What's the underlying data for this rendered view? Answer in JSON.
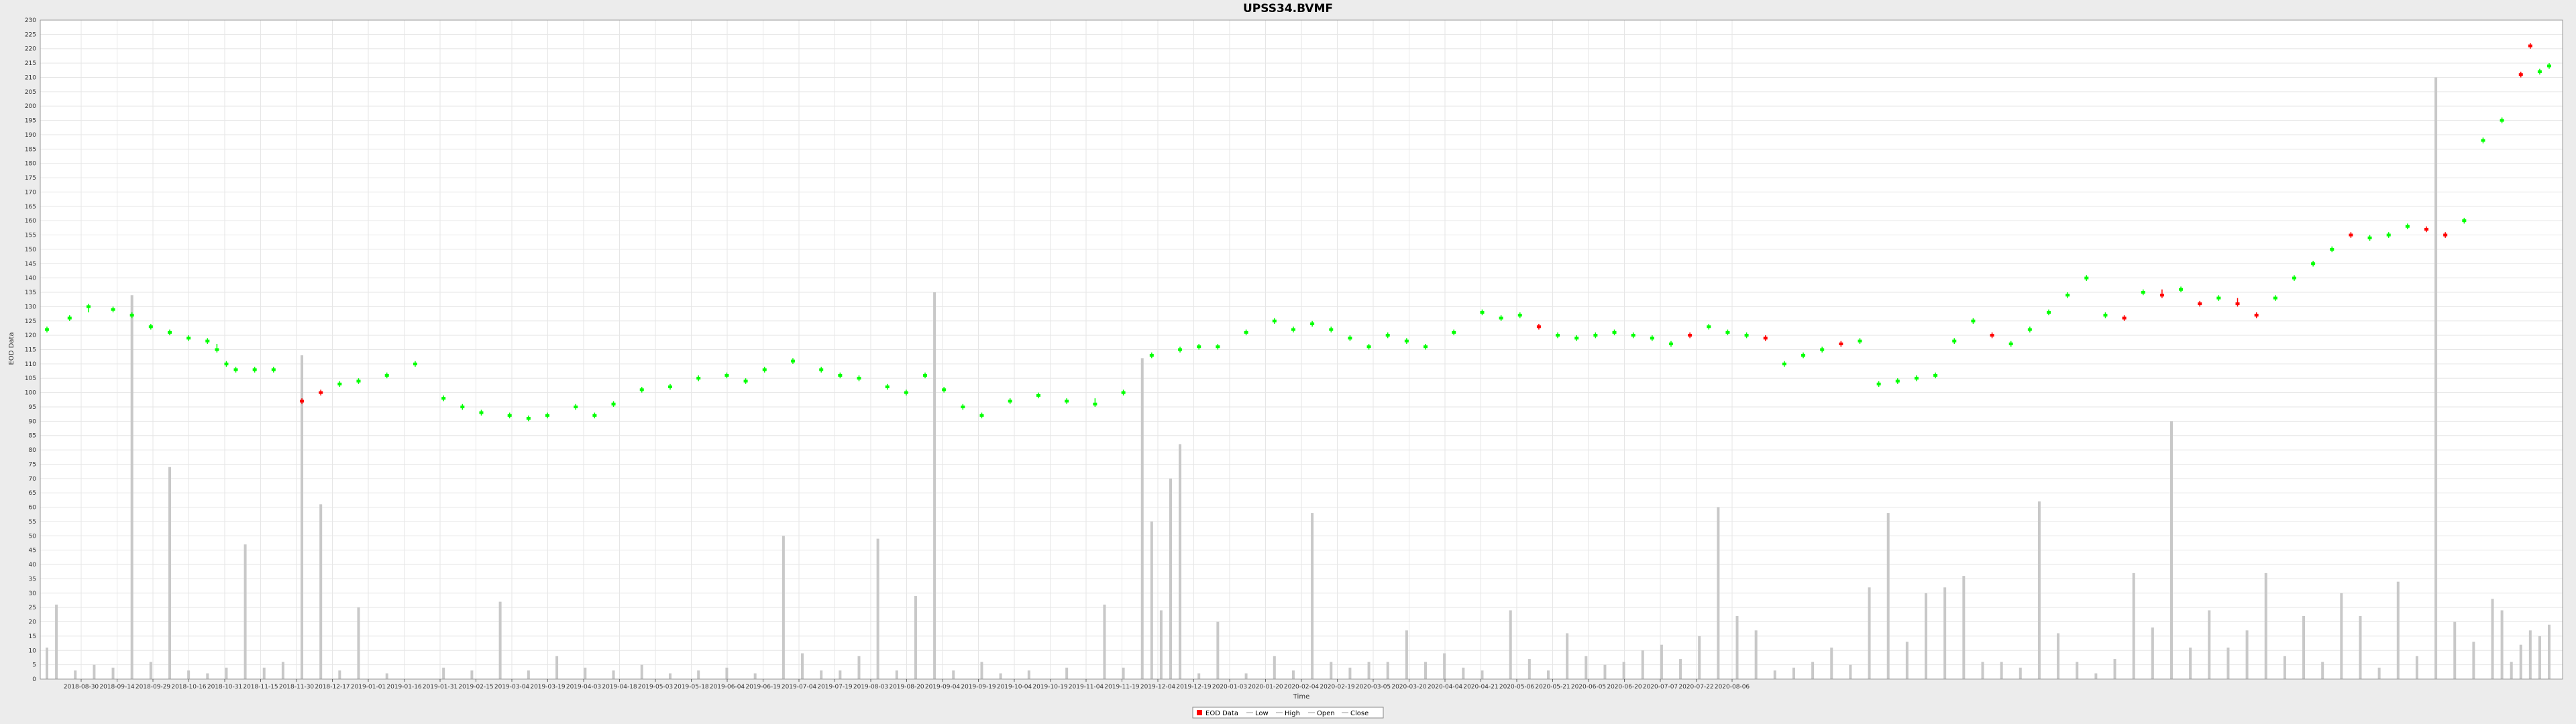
{
  "chart_data": {
    "type": "candlestick",
    "title": "UPSS34.BVMF",
    "xlabel": "Time",
    "ylabel": "EOD Data",
    "y_ticks": [
      0,
      5,
      10,
      15,
      20,
      25,
      30,
      35,
      40,
      45,
      50,
      55,
      60,
      65,
      70,
      75,
      80,
      85,
      90,
      95,
      100,
      105,
      110,
      115,
      120,
      125,
      130,
      135,
      140,
      145,
      150,
      155,
      160,
      165,
      170,
      175,
      180,
      185,
      190,
      195,
      200,
      205,
      210,
      215,
      220,
      225,
      230
    ],
    "ylim": [
      0,
      230
    ],
    "x_ticks": [
      "2018-08-30",
      "2018-09-14",
      "2018-09-29",
      "2018-10-16",
      "2018-10-31",
      "2018-11-15",
      "2018-11-30",
      "2018-12-17",
      "2019-01-01",
      "2019-01-16",
      "2019-01-31",
      "2019-02-15",
      "2019-03-04",
      "2019-03-19",
      "2019-04-03",
      "2019-04-18",
      "2019-05-03",
      "2019-05-18",
      "2019-06-04",
      "2019-06-19",
      "2019-07-04",
      "2019-07-19",
      "2019-08-03",
      "2019-08-20",
      "2019-09-04",
      "2019-09-19",
      "2019-10-04",
      "2019-10-19",
      "2019-11-04",
      "2019-11-19",
      "2019-12-04",
      "2019-12-19",
      "2020-01-03",
      "2020-01-20",
      "2020-02-04",
      "2020-02-19",
      "2020-03-05",
      "2020-03-20",
      "2020-04-04",
      "2020-04-21",
      "2020-05-06",
      "2020-05-21",
      "2020-06-05",
      "2020-06-20",
      "2020-07-07",
      "2020-07-22",
      "2020-08-06"
    ],
    "grid": true,
    "legend_position": "bottom-center",
    "legend": [
      "EOD Data",
      "Low",
      "High",
      "Open",
      "Close"
    ],
    "colors": {
      "up": "#00ff00",
      "down": "#ff0000",
      "volume": "#c8c8c8",
      "plot_bg": "#ffffff",
      "grid": "#e6e6e6",
      "page_bg": "#ececec"
    },
    "price_points": [
      [
        0,
        122,
        121,
        123,
        1
      ],
      [
        12,
        126,
        125,
        127,
        1
      ],
      [
        22,
        130,
        128,
        131,
        1
      ],
      [
        35,
        129,
        128,
        130,
        1
      ],
      [
        45,
        127,
        126,
        128,
        1
      ],
      [
        55,
        123,
        122,
        124,
        1
      ],
      [
        65,
        121,
        120,
        122,
        1
      ],
      [
        75,
        119,
        118,
        120,
        1
      ],
      [
        85,
        118,
        117,
        119,
        1
      ],
      [
        90,
        115,
        114,
        117,
        1
      ],
      [
        95,
        110,
        109,
        111,
        1
      ],
      [
        100,
        108,
        107,
        109,
        1
      ],
      [
        110,
        108,
        107,
        109,
        1
      ],
      [
        120,
        108,
        107,
        109,
        1
      ],
      [
        135,
        97,
        96,
        98,
        0
      ],
      [
        145,
        100,
        99,
        101,
        0
      ],
      [
        155,
        103,
        102,
        104,
        1
      ],
      [
        165,
        104,
        103,
        105,
        1
      ],
      [
        180,
        106,
        105,
        107,
        1
      ],
      [
        195,
        110,
        109,
        111,
        1
      ],
      [
        210,
        98,
        97,
        99,
        1
      ],
      [
        220,
        95,
        94,
        96,
        1
      ],
      [
        230,
        93,
        92,
        94,
        1
      ],
      [
        245,
        92,
        91,
        93,
        1
      ],
      [
        255,
        91,
        90,
        92,
        1
      ],
      [
        265,
        92,
        91,
        93,
        1
      ],
      [
        280,
        95,
        94,
        96,
        1
      ],
      [
        290,
        92,
        91,
        93,
        1
      ],
      [
        300,
        96,
        95,
        97,
        1
      ],
      [
        315,
        101,
        100,
        102,
        1
      ],
      [
        330,
        102,
        101,
        103,
        1
      ],
      [
        345,
        105,
        104,
        106,
        1
      ],
      [
        360,
        106,
        105,
        107,
        1
      ],
      [
        370,
        104,
        103,
        105,
        1
      ],
      [
        380,
        108,
        107,
        109,
        1
      ],
      [
        395,
        111,
        110,
        112,
        1
      ],
      [
        410,
        108,
        107,
        109,
        1
      ],
      [
        420,
        106,
        105,
        107,
        1
      ],
      [
        430,
        105,
        104,
        106,
        1
      ],
      [
        445,
        102,
        101,
        103,
        1
      ],
      [
        455,
        100,
        99,
        101,
        1
      ],
      [
        465,
        106,
        105,
        107,
        1
      ],
      [
        475,
        101,
        100,
        102,
        1
      ],
      [
        485,
        95,
        94,
        96,
        1
      ],
      [
        495,
        92,
        91,
        93,
        1
      ],
      [
        510,
        97,
        96,
        98,
        1
      ],
      [
        525,
        99,
        98,
        100,
        1
      ],
      [
        540,
        97,
        96,
        98,
        1
      ],
      [
        555,
        96,
        95,
        98,
        1
      ],
      [
        570,
        100,
        99,
        101,
        1
      ],
      [
        585,
        113,
        112,
        114,
        1
      ],
      [
        600,
        115,
        114,
        116,
        1
      ],
      [
        610,
        116,
        115,
        117,
        1
      ],
      [
        620,
        116,
        115,
        117,
        1
      ],
      [
        635,
        121,
        120,
        122,
        1
      ],
      [
        650,
        125,
        124,
        126,
        1
      ],
      [
        660,
        122,
        121,
        123,
        1
      ],
      [
        670,
        124,
        123,
        125,
        1
      ],
      [
        680,
        122,
        121,
        123,
        1
      ],
      [
        690,
        119,
        118,
        120,
        1
      ],
      [
        700,
        116,
        115,
        117,
        1
      ],
      [
        710,
        120,
        119,
        121,
        1
      ],
      [
        720,
        118,
        117,
        119,
        1
      ],
      [
        730,
        116,
        115,
        117,
        1
      ],
      [
        745,
        121,
        120,
        122,
        1
      ],
      [
        760,
        128,
        127,
        129,
        1
      ],
      [
        770,
        126,
        125,
        127,
        1
      ],
      [
        780,
        127,
        126,
        128,
        1
      ],
      [
        790,
        123,
        122,
        124,
        0
      ],
      [
        800,
        120,
        119,
        121,
        1
      ],
      [
        810,
        119,
        118,
        120,
        1
      ],
      [
        820,
        120,
        119,
        121,
        1
      ],
      [
        830,
        121,
        120,
        122,
        1
      ],
      [
        840,
        120,
        119,
        121,
        1
      ],
      [
        850,
        119,
        118,
        120,
        1
      ],
      [
        860,
        117,
        116,
        118,
        1
      ],
      [
        870,
        120,
        119,
        121,
        0
      ],
      [
        880,
        123,
        122,
        124,
        1
      ],
      [
        890,
        121,
        120,
        122,
        1
      ],
      [
        900,
        120,
        119,
        121,
        1
      ],
      [
        910,
        119,
        118,
        120,
        0
      ],
      [
        920,
        110,
        109,
        111,
        1
      ],
      [
        930,
        113,
        112,
        114,
        1
      ],
      [
        940,
        115,
        114,
        116,
        1
      ],
      [
        950,
        117,
        116,
        118,
        0
      ],
      [
        960,
        118,
        117,
        119,
        1
      ],
      [
        970,
        103,
        102,
        104,
        1
      ],
      [
        980,
        104,
        103,
        105,
        1
      ],
      [
        990,
        105,
        104,
        106,
        1
      ],
      [
        1000,
        106,
        105,
        107,
        1
      ],
      [
        1010,
        118,
        117,
        119,
        1
      ],
      [
        1020,
        125,
        124,
        126,
        1
      ],
      [
        1030,
        120,
        119,
        121,
        0
      ],
      [
        1040,
        117,
        116,
        118,
        1
      ],
      [
        1050,
        122,
        121,
        123,
        1
      ],
      [
        1060,
        128,
        127,
        129,
        1
      ],
      [
        1070,
        134,
        133,
        135,
        1
      ],
      [
        1080,
        140,
        139,
        141,
        1
      ],
      [
        1090,
        127,
        126,
        128,
        1
      ],
      [
        1100,
        126,
        125,
        127,
        0
      ],
      [
        1110,
        135,
        134,
        136,
        1
      ],
      [
        1120,
        134,
        133,
        136,
        0
      ],
      [
        1130,
        136,
        135,
        137,
        1
      ],
      [
        1140,
        131,
        130,
        132,
        0
      ],
      [
        1150,
        133,
        132,
        134,
        1
      ],
      [
        1160,
        131,
        130,
        133,
        0
      ],
      [
        1170,
        127,
        126,
        128,
        0
      ],
      [
        1180,
        133,
        132,
        134,
        1
      ],
      [
        1190,
        140,
        139,
        141,
        1
      ],
      [
        1200,
        145,
        144,
        146,
        1
      ],
      [
        1210,
        150,
        149,
        151,
        1
      ],
      [
        1220,
        155,
        154,
        156,
        0
      ],
      [
        1230,
        154,
        153,
        155,
        1
      ],
      [
        1240,
        155,
        154,
        156,
        1
      ],
      [
        1250,
        158,
        157,
        159,
        1
      ],
      [
        1260,
        157,
        156,
        158,
        0
      ],
      [
        1270,
        155,
        154,
        156,
        0
      ],
      [
        1280,
        160,
        159,
        161,
        1
      ],
      [
        1290,
        188,
        187,
        189,
        1
      ],
      [
        1300,
        195,
        194,
        196,
        1
      ],
      [
        1310,
        211,
        210,
        212,
        0
      ],
      [
        1315,
        221,
        220,
        222,
        0
      ],
      [
        1320,
        212,
        211,
        213,
        1
      ],
      [
        1325,
        214,
        213,
        215,
        1
      ]
    ],
    "volume": [
      [
        0,
        11
      ],
      [
        5,
        26
      ],
      [
        15,
        3
      ],
      [
        25,
        5
      ],
      [
        35,
        4
      ],
      [
        45,
        134
      ],
      [
        55,
        6
      ],
      [
        65,
        74
      ],
      [
        75,
        3
      ],
      [
        85,
        2
      ],
      [
        95,
        4
      ],
      [
        105,
        47
      ],
      [
        115,
        4
      ],
      [
        125,
        6
      ],
      [
        135,
        113
      ],
      [
        145,
        61
      ],
      [
        155,
        3
      ],
      [
        165,
        25
      ],
      [
        180,
        2
      ],
      [
        210,
        4
      ],
      [
        225,
        3
      ],
      [
        240,
        27
      ],
      [
        255,
        3
      ],
      [
        270,
        8
      ],
      [
        285,
        4
      ],
      [
        300,
        3
      ],
      [
        315,
        5
      ],
      [
        330,
        2
      ],
      [
        345,
        3
      ],
      [
        360,
        4
      ],
      [
        375,
        2
      ],
      [
        390,
        50
      ],
      [
        400,
        9
      ],
      [
        410,
        3
      ],
      [
        420,
        3
      ],
      [
        430,
        8
      ],
      [
        440,
        49
      ],
      [
        450,
        3
      ],
      [
        460,
        29
      ],
      [
        470,
        135
      ],
      [
        480,
        3
      ],
      [
        495,
        6
      ],
      [
        505,
        2
      ],
      [
        520,
        3
      ],
      [
        540,
        4
      ],
      [
        560,
        26
      ],
      [
        570,
        4
      ],
      [
        580,
        112
      ],
      [
        585,
        55
      ],
      [
        590,
        24
      ],
      [
        595,
        70
      ],
      [
        600,
        82
      ],
      [
        610,
        2
      ],
      [
        620,
        20
      ],
      [
        635,
        2
      ],
      [
        650,
        8
      ],
      [
        660,
        3
      ],
      [
        670,
        58
      ],
      [
        680,
        6
      ],
      [
        690,
        4
      ],
      [
        700,
        6
      ],
      [
        710,
        6
      ],
      [
        720,
        17
      ],
      [
        730,
        6
      ],
      [
        740,
        9
      ],
      [
        750,
        4
      ],
      [
        760,
        3
      ],
      [
        775,
        24
      ],
      [
        785,
        7
      ],
      [
        795,
        3
      ],
      [
        805,
        16
      ],
      [
        815,
        8
      ],
      [
        825,
        5
      ],
      [
        835,
        6
      ],
      [
        845,
        10
      ],
      [
        855,
        12
      ],
      [
        865,
        7
      ],
      [
        875,
        15
      ],
      [
        885,
        60
      ],
      [
        895,
        22
      ],
      [
        905,
        17
      ],
      [
        915,
        3
      ],
      [
        925,
        4
      ],
      [
        935,
        6
      ],
      [
        945,
        11
      ],
      [
        955,
        5
      ],
      [
        965,
        32
      ],
      [
        975,
        58
      ],
      [
        985,
        13
      ],
      [
        995,
        30
      ],
      [
        1005,
        32
      ],
      [
        1015,
        36
      ],
      [
        1025,
        6
      ],
      [
        1035,
        6
      ],
      [
        1045,
        4
      ],
      [
        1055,
        62
      ],
      [
        1065,
        16
      ],
      [
        1075,
        6
      ],
      [
        1085,
        2
      ],
      [
        1095,
        7
      ],
      [
        1105,
        37
      ],
      [
        1115,
        18
      ],
      [
        1125,
        90
      ],
      [
        1135,
        11
      ],
      [
        1145,
        24
      ],
      [
        1155,
        11
      ],
      [
        1165,
        17
      ],
      [
        1175,
        37
      ],
      [
        1185,
        8
      ],
      [
        1195,
        22
      ],
      [
        1205,
        6
      ],
      [
        1215,
        30
      ],
      [
        1225,
        22
      ],
      [
        1235,
        4
      ],
      [
        1245,
        34
      ],
      [
        1255,
        8
      ],
      [
        1265,
        210
      ],
      [
        1275,
        20
      ],
      [
        1285,
        13
      ],
      [
        1295,
        28
      ],
      [
        1300,
        24
      ],
      [
        1305,
        6
      ],
      [
        1310,
        12
      ],
      [
        1315,
        17
      ],
      [
        1320,
        15
      ],
      [
        1325,
        19
      ]
    ]
  }
}
